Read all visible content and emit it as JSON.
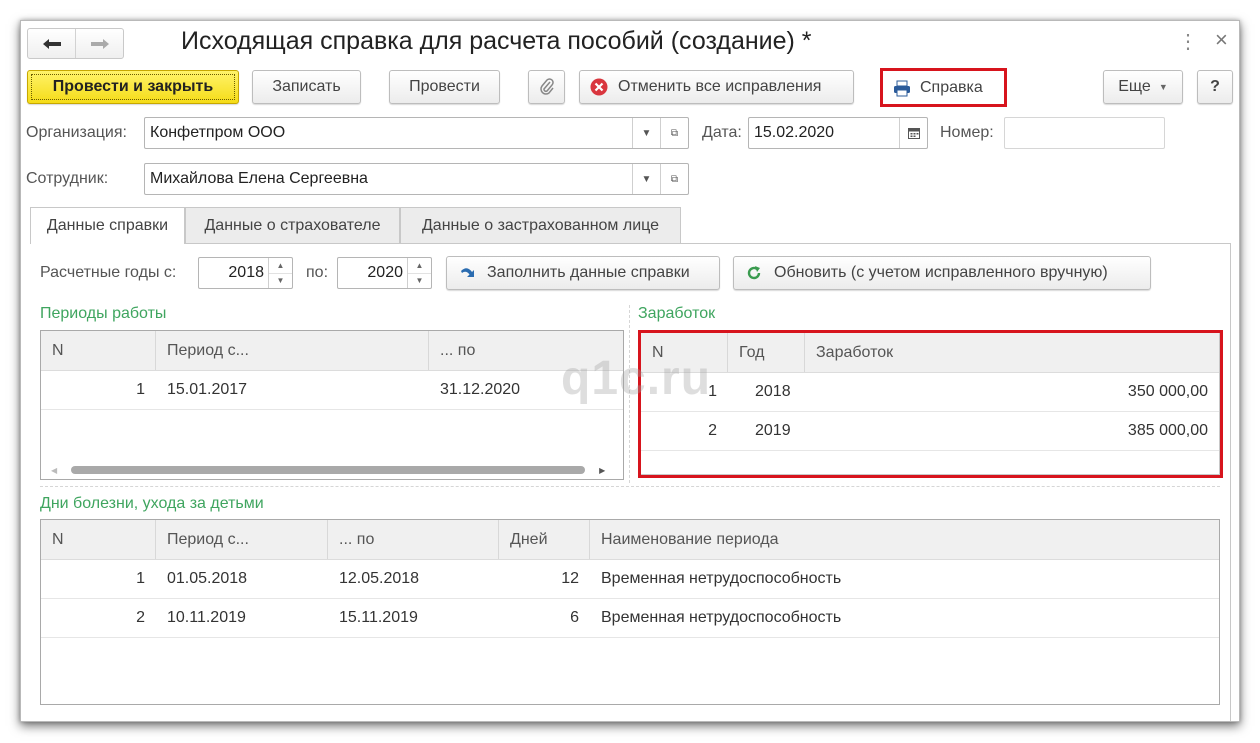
{
  "window": {
    "title": "Исходящая справка для расчета пособий (создание) *",
    "nav_back_icon": "arrow-left-icon",
    "nav_forward_icon": "arrow-right-icon",
    "menu_icon": "more-vertical-icon",
    "close_icon": "close-icon",
    "close_glyph": "×",
    "menu_glyph": "⋮"
  },
  "toolbar": {
    "post_and_close": "Провести и закрыть",
    "save": "Записать",
    "post": "Провести",
    "attach_icon": "paperclip-icon",
    "cancel_corrections": "Отменить все исправления",
    "print_certificate": "Справка",
    "more": "Еще",
    "help": "?"
  },
  "header_fields": {
    "organization_label": "Организация:",
    "organization_value": "Конфетпром ООО",
    "date_label": "Дата:",
    "date_value": "15.02.2020",
    "number_label": "Номер:",
    "number_value": "",
    "employee_label": "Сотрудник:",
    "employee_value": "Михайлова Елена Сергеевна"
  },
  "tabs": [
    {
      "label": "Данные справки",
      "active": true
    },
    {
      "label": "Данные о страхователе",
      "active": false
    },
    {
      "label": "Данные о застрахованном лице",
      "active": false
    }
  ],
  "calc_years": {
    "from_label": "Расчетные годы с:",
    "from_value": "2018",
    "to_label": "по:",
    "to_value": "2020",
    "fill_button": "Заполнить данные справки",
    "refresh_button": "Обновить (с учетом исправленного вручную)"
  },
  "work_periods": {
    "title": "Периоды работы",
    "columns": [
      "N",
      "Период с...",
      "... по"
    ],
    "rows": [
      {
        "n": "1",
        "from": "15.01.2017",
        "to": "31.12.2020"
      }
    ]
  },
  "earnings": {
    "title": "Заработок",
    "columns": [
      "N",
      "Год",
      "Заработок"
    ],
    "rows": [
      {
        "n": "1",
        "year": "2018",
        "amount": "350 000,00"
      },
      {
        "n": "2",
        "year": "2019",
        "amount": "385 000,00"
      }
    ]
  },
  "sick_days": {
    "title": "Дни болезни, ухода за детьми",
    "columns": [
      "N",
      "Период с...",
      "... по",
      "Дней",
      "Наименование периода"
    ],
    "rows": [
      {
        "n": "1",
        "from": "01.05.2018",
        "to": "12.05.2018",
        "days": "12",
        "name": "Временная нетрудоспособность"
      },
      {
        "n": "2",
        "from": "10.11.2019",
        "to": "15.11.2019",
        "days": "6",
        "name": "Временная нетрудоспособность"
      }
    ]
  },
  "watermark": "q1c.ru",
  "colors": {
    "highlight": "#d7141d",
    "group_title": "#3fa55f",
    "primary_button": "#f5dc17"
  }
}
